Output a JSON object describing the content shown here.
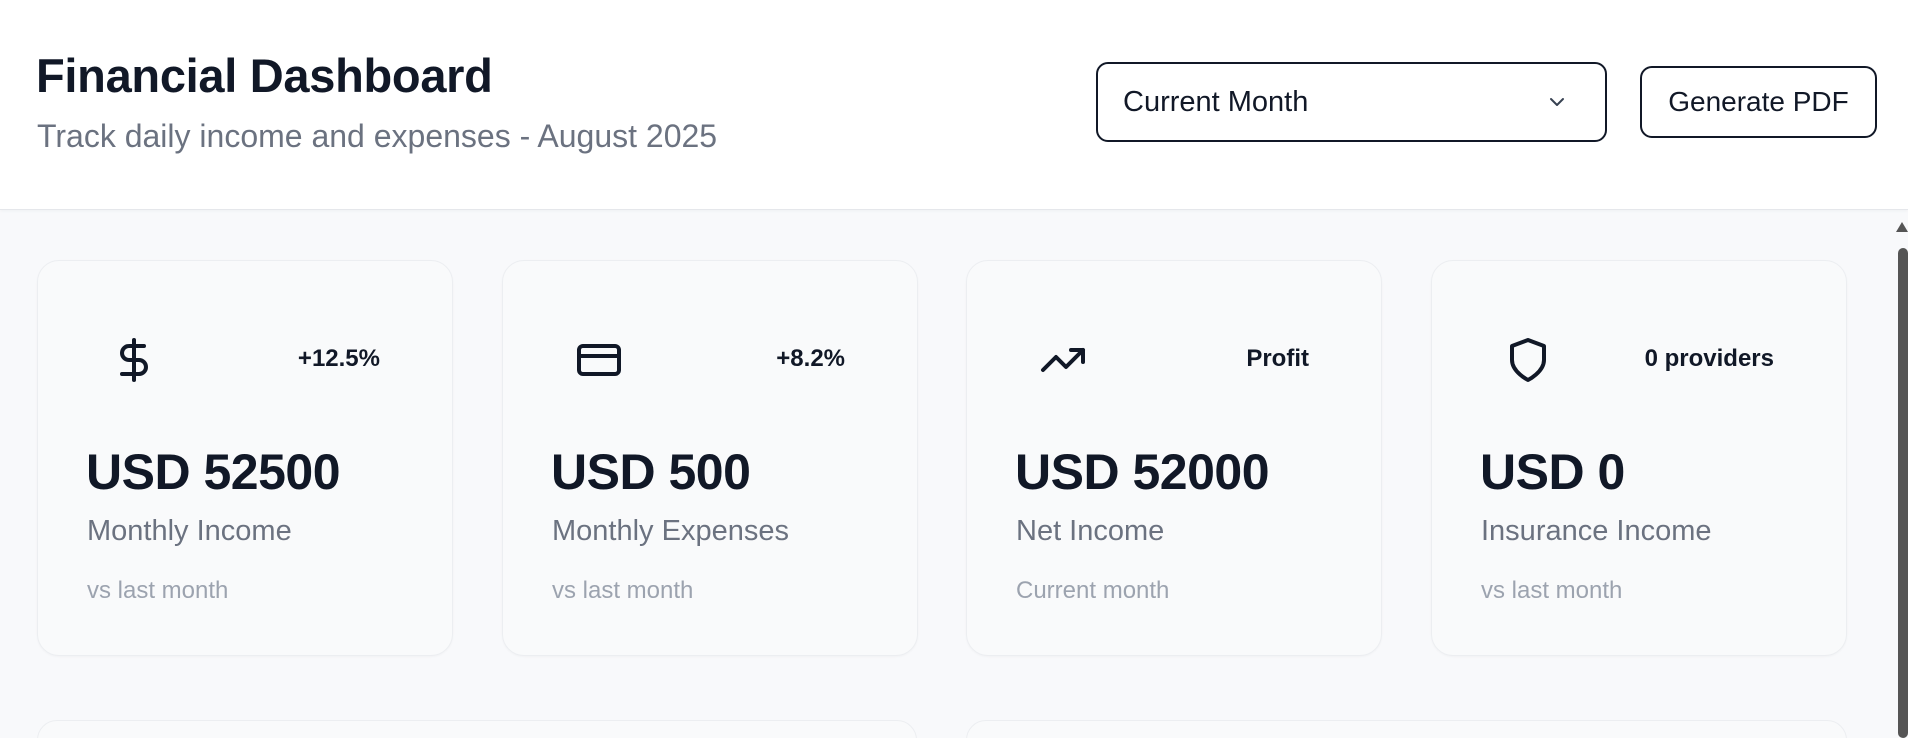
{
  "header": {
    "title": "Financial Dashboard",
    "subtitle": "Track daily income and expenses - August 2025",
    "period_select": {
      "value": "Current Month",
      "icon": "chevron-down-icon"
    },
    "generate_pdf_label": "Generate PDF"
  },
  "cards": [
    {
      "icon": "dollar-sign-icon",
      "badge": "+12.5%",
      "value": "USD 52500",
      "label": "Monthly Income",
      "sub": "vs last month"
    },
    {
      "icon": "credit-card-icon",
      "badge": "+8.2%",
      "value": "USD 500",
      "label": "Monthly Expenses",
      "sub": "vs last month"
    },
    {
      "icon": "trending-up-icon",
      "badge": "Profit",
      "value": "USD 52000",
      "label": "Net Income",
      "sub": "Current month"
    },
    {
      "icon": "shield-icon",
      "badge": "0 providers",
      "value": "USD 0",
      "label": "Insurance Income",
      "sub": "vs last month"
    }
  ],
  "colors": {
    "text_primary": "#111827",
    "text_secondary": "#6b7280",
    "text_muted": "#9ca3af",
    "card_bg": "#f9fafb",
    "page_bg": "#f8f9fb"
  }
}
